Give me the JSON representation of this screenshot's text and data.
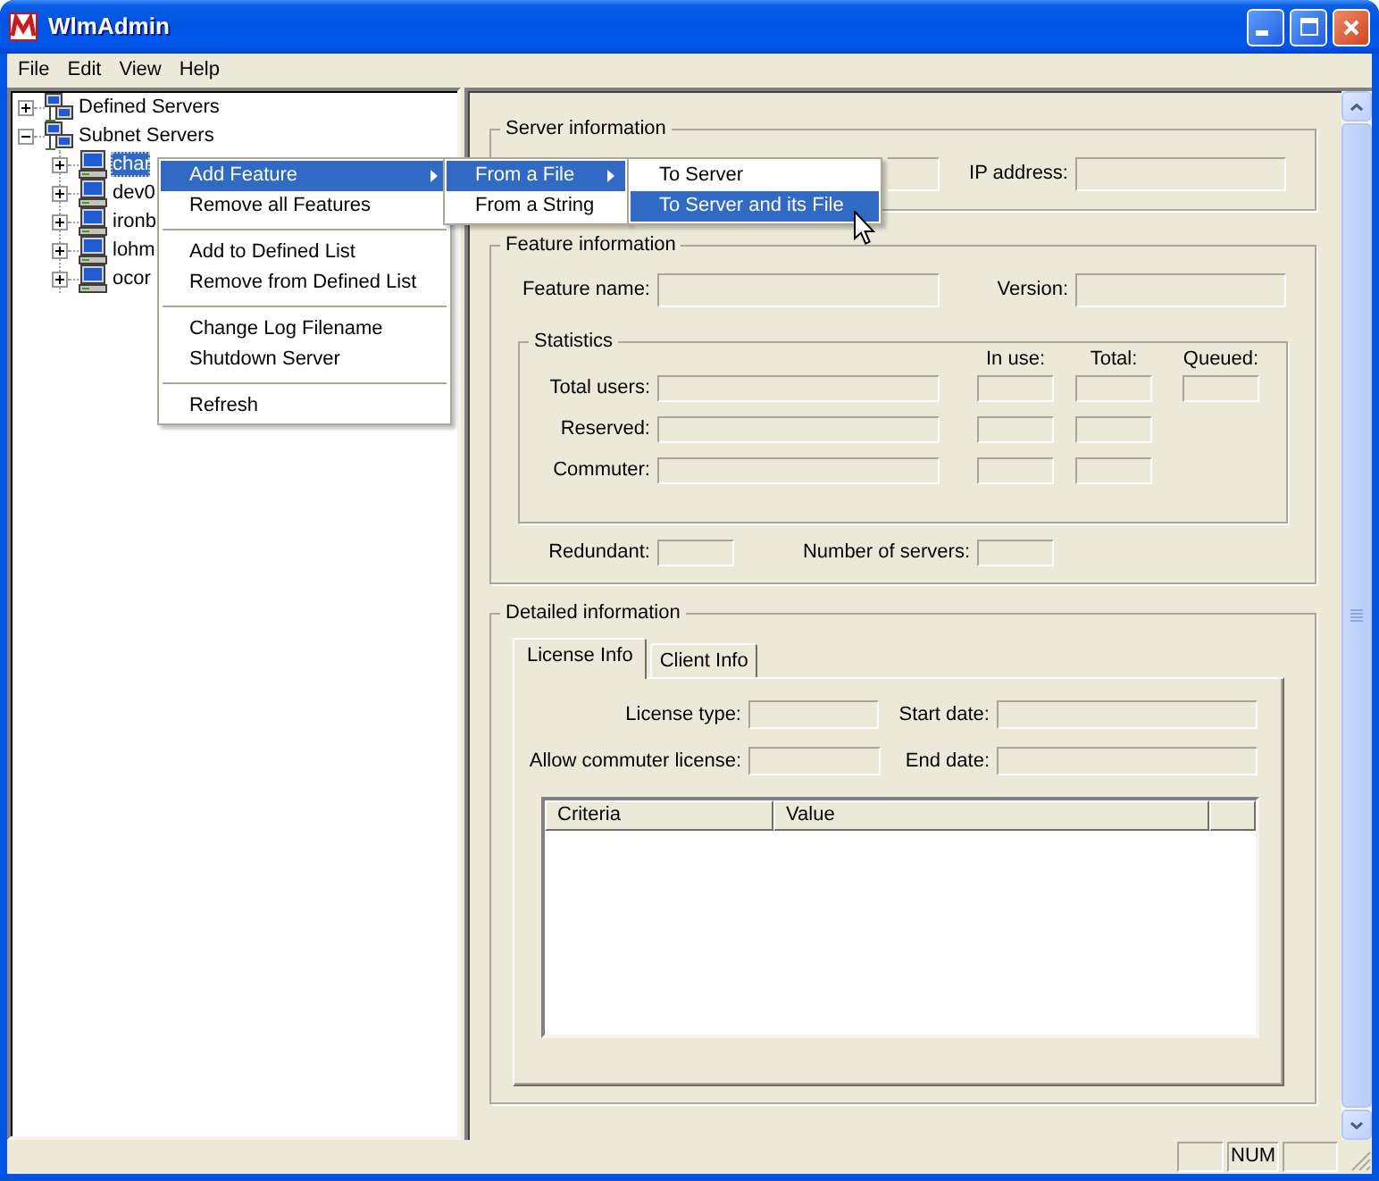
{
  "window": {
    "title": "WlmAdmin"
  },
  "menu_bar": [
    {
      "label": "File"
    },
    {
      "label": "Edit"
    },
    {
      "label": "View"
    },
    {
      "label": "Help"
    }
  ],
  "tree": [
    {
      "label": "Defined Servers",
      "expanded": false,
      "selected": false
    },
    {
      "label": "Subnet Servers",
      "expanded": true,
      "selected": false,
      "children": [
        {
          "label": "char",
          "expanded": false,
          "selected": true
        },
        {
          "label": "dev0",
          "expanded": false,
          "selected": false
        },
        {
          "label": "ironb",
          "expanded": false,
          "selected": false
        },
        {
          "label": "lohm",
          "expanded": false,
          "selected": false
        },
        {
          "label": "ocor",
          "expanded": false,
          "selected": false
        }
      ]
    }
  ],
  "context_menu": {
    "groups": [
      {
        "items": [
          {
            "label": "Add Feature",
            "selected": true,
            "submenu_arrow": true
          },
          {
            "label": "Remove all Features",
            "selected": false,
            "submenu_arrow": false
          }
        ]
      },
      {
        "items": [
          {
            "label": "Add to Defined List",
            "selected": false,
            "submenu_arrow": false
          },
          {
            "label": "Remove from Defined List",
            "selected": false,
            "submenu_arrow": false
          }
        ]
      },
      {
        "items": [
          {
            "label": "Change Log Filename",
            "selected": false,
            "submenu_arrow": false
          },
          {
            "label": "Shutdown Server",
            "selected": false,
            "submenu_arrow": false
          }
        ]
      },
      {
        "items": [
          {
            "label": "Refresh",
            "selected": false,
            "submenu_arrow": false
          }
        ]
      }
    ]
  },
  "submenus": [
    {
      "items": [
        {
          "label": "From a File",
          "selected": true,
          "submenu_arrow": true
        },
        {
          "label": "From a String",
          "selected": false,
          "submenu_arrow": false
        }
      ]
    },
    {
      "items": [
        {
          "label": "To Server",
          "selected": false,
          "submenu_arrow": false
        },
        {
          "label": "To Server and its File",
          "selected": true,
          "submenu_arrow": false
        }
      ]
    }
  ],
  "server_information": {
    "title": "Server information",
    "ip_address_label": "IP address:"
  },
  "feature_information": {
    "title": "Feature information",
    "feature_name_label": "Feature name:",
    "version_label": "Version:",
    "statistics": {
      "title": "Statistics",
      "columns": [
        "In use:",
        "Total:",
        "Queued:"
      ],
      "rows": [
        {
          "label": "Total users:",
          "queued_field": true
        },
        {
          "label": "Reserved:",
          "queued_field": false
        },
        {
          "label": "Commuter:",
          "queued_field": false
        }
      ]
    },
    "redundant_label": "Redundant:",
    "servers_label": "Number of servers:"
  },
  "detailed_information": {
    "title": "Detailed information",
    "tabs": [
      {
        "label": "License Info",
        "selected": true
      },
      {
        "label": "Client Info",
        "selected": false
      }
    ],
    "license_type_label": "License type:",
    "start_date_label": "Start date:",
    "commuter_license_label": "Allow commuter license:",
    "end_date_label": "End date:",
    "list_columns": [
      "Criteria",
      "Value"
    ]
  },
  "status_bar": {
    "indicator": "NUM"
  }
}
